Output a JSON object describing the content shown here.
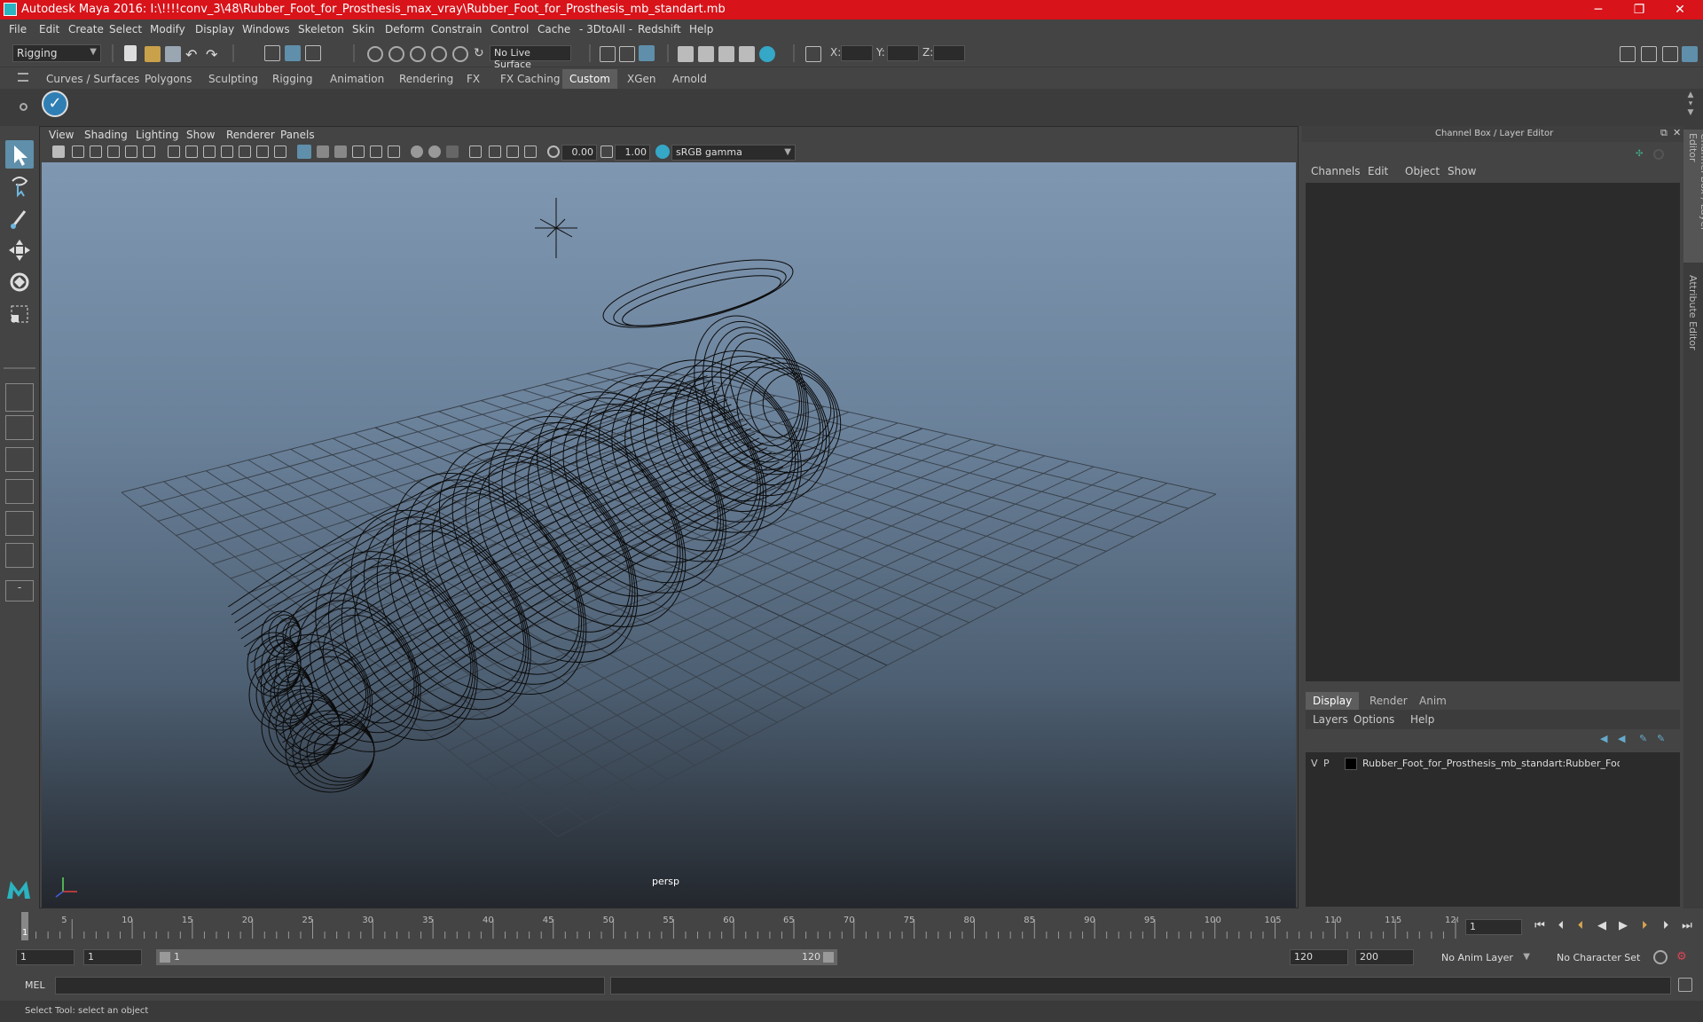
{
  "titlebar": {
    "title": "Autodesk Maya 2016: I:\\!!!!conv_3\\48\\Rubber_Foot_for_Prosthesis_max_vray\\Rubber_Foot_for_Prosthesis_mb_standart.mb",
    "minimize": "─",
    "maximize": "❐",
    "close": "✕"
  },
  "menubar": [
    "File",
    "Edit",
    "Create",
    "Select",
    "Modify",
    "Display",
    "Windows",
    "Skeleton",
    "Skin",
    "Deform",
    "Constrain",
    "Control",
    "Cache",
    "- 3DtoAll -",
    "Redshift",
    "Help"
  ],
  "statusline": {
    "mode": "Rigging",
    "live_surface": "No Live Surface",
    "x_label": "X:",
    "y_label": "Y:",
    "z_label": "Z:"
  },
  "shelf_tabs": [
    "Curves / Surfaces",
    "Polygons",
    "Sculpting",
    "Rigging",
    "Animation",
    "Rendering",
    "FX",
    "FX Caching",
    "Custom",
    "XGen",
    "Arnold"
  ],
  "shelf_active": "Custom",
  "panel_menu": [
    "View",
    "Shading",
    "Lighting",
    "Show",
    "Renderer",
    "Panels"
  ],
  "panel_toolbar": {
    "exposure": "0.00",
    "gamma": "1.00",
    "color_space": "sRGB gamma"
  },
  "viewport": {
    "camera_label": "persp"
  },
  "channel_box": {
    "title": "Channel Box / Layer Editor",
    "menu": [
      "Channels",
      "Edit",
      "Object",
      "Show"
    ],
    "layer_tabs": [
      "Display",
      "Render",
      "Anim"
    ],
    "layer_tab_active": "Display",
    "layer_menu": [
      "Layers",
      "Options",
      "Help"
    ],
    "layer": {
      "v": "V",
      "p": "P",
      "name": "Rubber_Foot_for_Prosthesis_mb_standart:Rubber_Foot_"
    }
  },
  "right_strip": {
    "tab1": "Channel Box / Layer Editor",
    "tab2": "Attribute Editor"
  },
  "timeline": {
    "ticks": [
      "5",
      "10",
      "15",
      "20",
      "25",
      "30",
      "35",
      "40",
      "45",
      "50",
      "55",
      "60",
      "65",
      "70",
      "75",
      "80",
      "85",
      "90",
      "95",
      "100",
      "105",
      "110",
      "115",
      "120"
    ],
    "current_frame_marker": "1",
    "current_frame_field": "1"
  },
  "range": {
    "start": "1",
    "playback_start": "1",
    "slider_start": "1",
    "slider_end": "120",
    "playback_end": "120",
    "end": "200",
    "anim_layer": "No Anim Layer",
    "character_set": "No Character Set"
  },
  "cmdline": {
    "label": "MEL"
  },
  "helpline": {
    "text": "Select Tool: select an object"
  }
}
